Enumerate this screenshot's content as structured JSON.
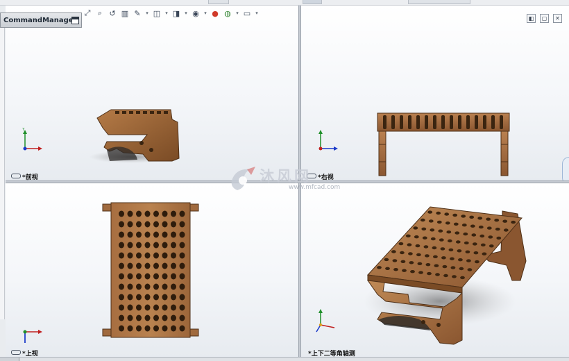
{
  "app": {
    "command_manager_label": "CommandManager"
  },
  "headsup_toolbar": {
    "tools": [
      {
        "name": "zoom-to-fit-icon",
        "glyph": "⤢"
      },
      {
        "name": "zoom-to-area-icon",
        "glyph": "⌕"
      },
      {
        "name": "previous-view-icon",
        "glyph": "↺"
      },
      {
        "name": "section-view-icon",
        "glyph": "▥"
      },
      {
        "name": "dynamic-annotation-icon",
        "glyph": "✎"
      },
      {
        "name": "view-orientation-icon",
        "glyph": "◫"
      },
      {
        "name": "display-style-icon",
        "glyph": "◨"
      },
      {
        "name": "hide-show-items-icon",
        "glyph": "◉"
      },
      {
        "name": "edit-appearance-icon",
        "glyph": "●"
      },
      {
        "name": "apply-scene-icon",
        "glyph": "◍"
      },
      {
        "name": "view-settings-icon",
        "glyph": "▭"
      }
    ]
  },
  "viewport_controls": [
    {
      "name": "viewport-previous-icon",
      "glyph": "◧"
    },
    {
      "name": "viewport-maximize-icon",
      "glyph": "▢"
    },
    {
      "name": "viewport-close-icon",
      "glyph": "✕"
    }
  ],
  "viewports": {
    "front": {
      "label": "*前视"
    },
    "right": {
      "label": "*右视"
    },
    "top": {
      "label": "*上视"
    },
    "iso": {
      "label": "*上下二等角轴测"
    }
  },
  "watermark": {
    "brand": "沐风网",
    "url": "www.mfcad.com"
  },
  "colors": {
    "wood": "#a06a3e",
    "wood_dark": "#6b4322",
    "wood_light": "#c08a56",
    "triad_x": "#c02020",
    "triad_y": "#1f8f2a",
    "triad_z": "#1a39c9"
  }
}
